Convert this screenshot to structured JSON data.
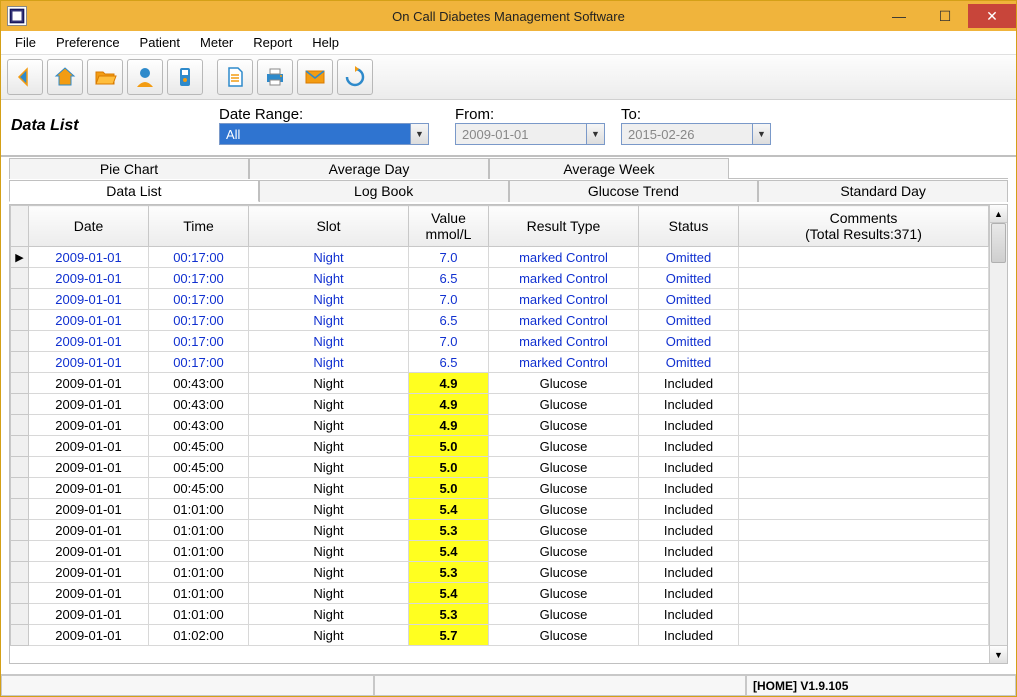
{
  "title": "On Call Diabetes Management Software",
  "menus": [
    "File",
    "Preference",
    "Patient",
    "Meter",
    "Report",
    "Help"
  ],
  "page_title": "Data List",
  "filter": {
    "range_label": "Date Range:",
    "range_value": "All",
    "from_label": "From:",
    "from_value": "2009-01-01",
    "to_label": "To:",
    "to_value": "2015-02-26"
  },
  "tabs_top": [
    "Pie Chart",
    "Average Day",
    "Average Week"
  ],
  "tabs_bottom": [
    "Data List",
    "Log Book",
    "Glucose Trend",
    "Standard Day"
  ],
  "active_tab": "Data List",
  "columns": [
    "Date",
    "Time",
    "Slot",
    "Value\nmmol/L",
    "Result Type",
    "Status",
    "Comments\n(Total Results:371)"
  ],
  "rows": [
    {
      "marker": "▶",
      "date": "2009-01-01",
      "time": "00:17:00",
      "slot": "Night",
      "value": "7.0",
      "rtype": "marked Control",
      "status": "Omitted",
      "blue": true,
      "hl": false
    },
    {
      "marker": "",
      "date": "2009-01-01",
      "time": "00:17:00",
      "slot": "Night",
      "value": "6.5",
      "rtype": "marked Control",
      "status": "Omitted",
      "blue": true,
      "hl": false
    },
    {
      "marker": "",
      "date": "2009-01-01",
      "time": "00:17:00",
      "slot": "Night",
      "value": "7.0",
      "rtype": "marked Control",
      "status": "Omitted",
      "blue": true,
      "hl": false
    },
    {
      "marker": "",
      "date": "2009-01-01",
      "time": "00:17:00",
      "slot": "Night",
      "value": "6.5",
      "rtype": "marked Control",
      "status": "Omitted",
      "blue": true,
      "hl": false
    },
    {
      "marker": "",
      "date": "2009-01-01",
      "time": "00:17:00",
      "slot": "Night",
      "value": "7.0",
      "rtype": "marked Control",
      "status": "Omitted",
      "blue": true,
      "hl": false
    },
    {
      "marker": "",
      "date": "2009-01-01",
      "time": "00:17:00",
      "slot": "Night",
      "value": "6.5",
      "rtype": "marked Control",
      "status": "Omitted",
      "blue": true,
      "hl": false
    },
    {
      "marker": "",
      "date": "2009-01-01",
      "time": "00:43:00",
      "slot": "Night",
      "value": "4.9",
      "rtype": "Glucose",
      "status": "Included",
      "blue": false,
      "hl": true
    },
    {
      "marker": "",
      "date": "2009-01-01",
      "time": "00:43:00",
      "slot": "Night",
      "value": "4.9",
      "rtype": "Glucose",
      "status": "Included",
      "blue": false,
      "hl": true
    },
    {
      "marker": "",
      "date": "2009-01-01",
      "time": "00:43:00",
      "slot": "Night",
      "value": "4.9",
      "rtype": "Glucose",
      "status": "Included",
      "blue": false,
      "hl": true
    },
    {
      "marker": "",
      "date": "2009-01-01",
      "time": "00:45:00",
      "slot": "Night",
      "value": "5.0",
      "rtype": "Glucose",
      "status": "Included",
      "blue": false,
      "hl": true
    },
    {
      "marker": "",
      "date": "2009-01-01",
      "time": "00:45:00",
      "slot": "Night",
      "value": "5.0",
      "rtype": "Glucose",
      "status": "Included",
      "blue": false,
      "hl": true
    },
    {
      "marker": "",
      "date": "2009-01-01",
      "time": "00:45:00",
      "slot": "Night",
      "value": "5.0",
      "rtype": "Glucose",
      "status": "Included",
      "blue": false,
      "hl": true
    },
    {
      "marker": "",
      "date": "2009-01-01",
      "time": "01:01:00",
      "slot": "Night",
      "value": "5.4",
      "rtype": "Glucose",
      "status": "Included",
      "blue": false,
      "hl": true
    },
    {
      "marker": "",
      "date": "2009-01-01",
      "time": "01:01:00",
      "slot": "Night",
      "value": "5.3",
      "rtype": "Glucose",
      "status": "Included",
      "blue": false,
      "hl": true
    },
    {
      "marker": "",
      "date": "2009-01-01",
      "time": "01:01:00",
      "slot": "Night",
      "value": "5.4",
      "rtype": "Glucose",
      "status": "Included",
      "blue": false,
      "hl": true
    },
    {
      "marker": "",
      "date": "2009-01-01",
      "time": "01:01:00",
      "slot": "Night",
      "value": "5.3",
      "rtype": "Glucose",
      "status": "Included",
      "blue": false,
      "hl": true
    },
    {
      "marker": "",
      "date": "2009-01-01",
      "time": "01:01:00",
      "slot": "Night",
      "value": "5.4",
      "rtype": "Glucose",
      "status": "Included",
      "blue": false,
      "hl": true
    },
    {
      "marker": "",
      "date": "2009-01-01",
      "time": "01:01:00",
      "slot": "Night",
      "value": "5.3",
      "rtype": "Glucose",
      "status": "Included",
      "blue": false,
      "hl": true
    },
    {
      "marker": "",
      "date": "2009-01-01",
      "time": "01:02:00",
      "slot": "Night",
      "value": "5.7",
      "rtype": "Glucose",
      "status": "Included",
      "blue": false,
      "hl": true
    }
  ],
  "status": {
    "home": "[HOME] V1.9.105"
  },
  "toolbar_icons": [
    "back",
    "home",
    "open",
    "patient",
    "meter",
    "document",
    "print",
    "mail",
    "refresh"
  ]
}
